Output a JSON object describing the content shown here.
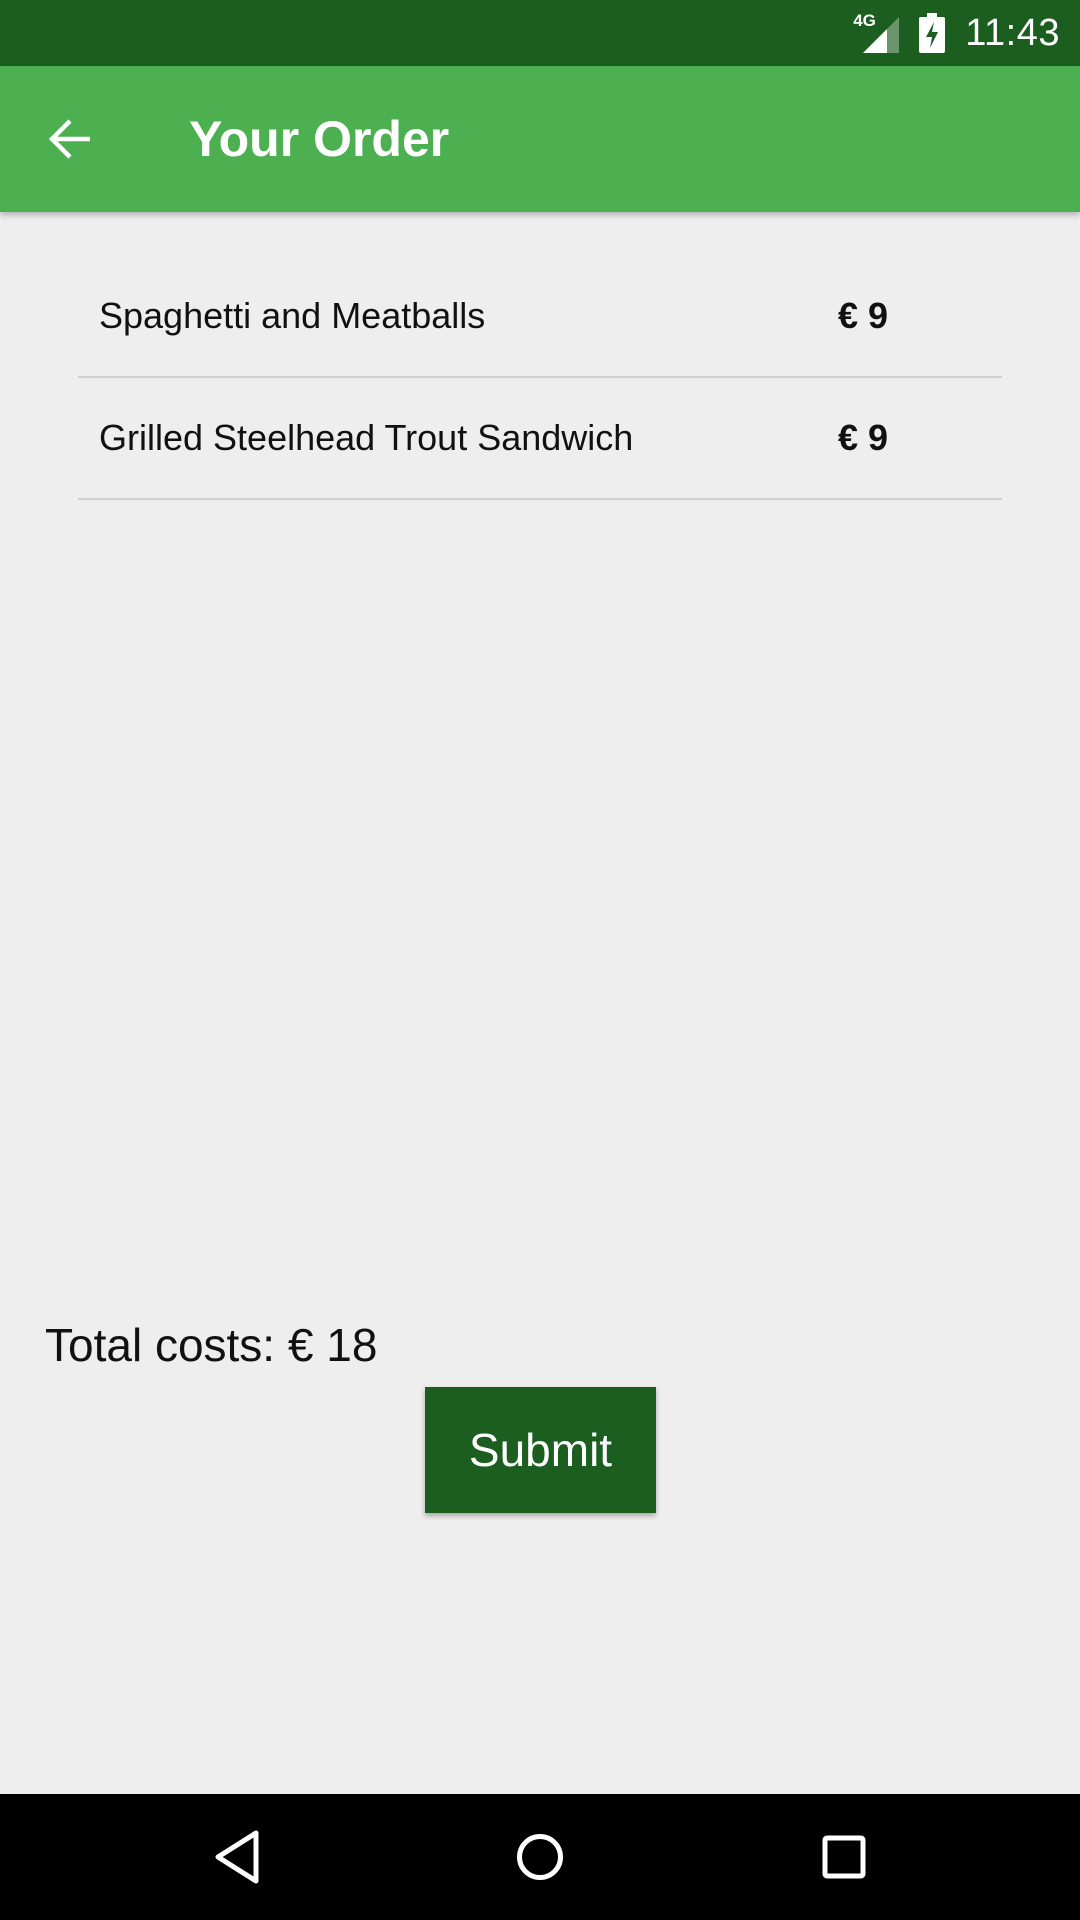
{
  "status_bar": {
    "network_label": "4G",
    "time": "11:43",
    "icons": [
      "signal-icon",
      "battery-charging-icon"
    ]
  },
  "app_bar": {
    "title": "Your Order",
    "back_icon": "arrow-back-icon",
    "color": "#4caf50"
  },
  "order": {
    "items": [
      {
        "name": "Spaghetti and Meatballs",
        "price": "€ 9"
      },
      {
        "name": "Grilled Steelhead Trout Sandwich",
        "price": "€ 9"
      }
    ],
    "total_text": "Total costs: € 18"
  },
  "actions": {
    "submit_label": "Submit",
    "submit_color": "#1b5e20"
  },
  "nav_bar": {
    "icons": [
      "back-triangle-icon",
      "home-circle-icon",
      "recents-square-icon"
    ]
  }
}
